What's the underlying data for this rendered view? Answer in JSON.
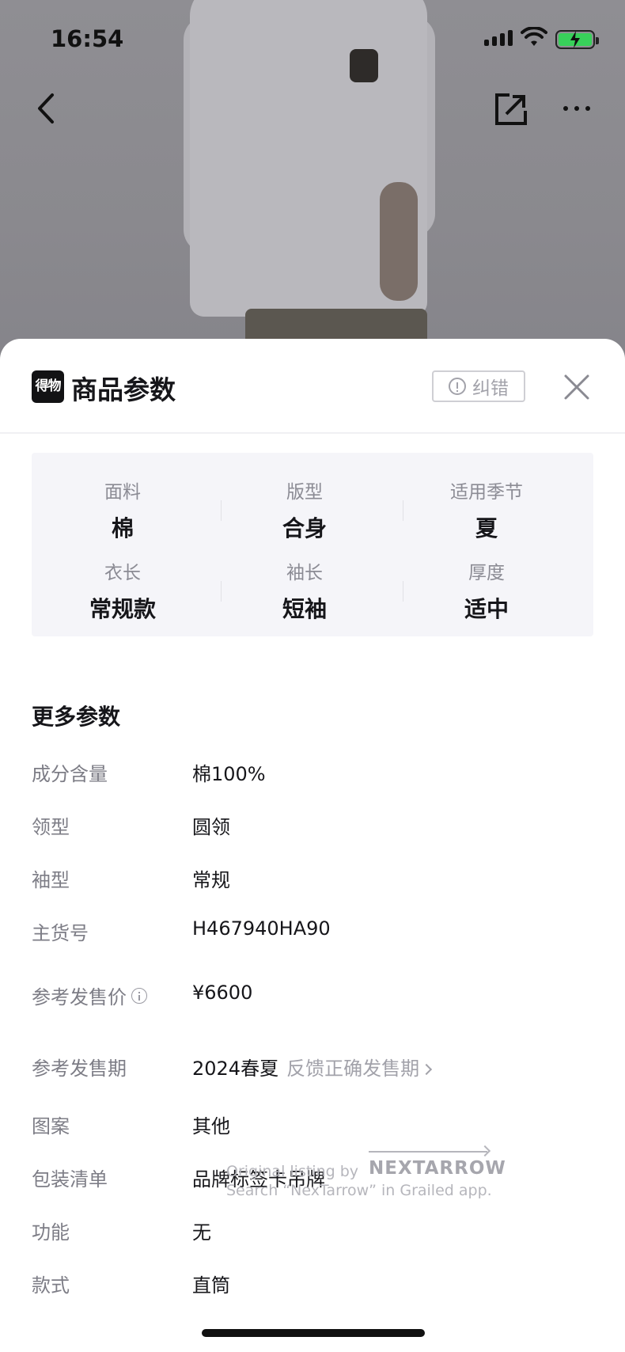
{
  "status_bar": {
    "time": "16:54",
    "battery_color": "#38d05a"
  },
  "nav": {
    "back_icon": "chevron-left-icon",
    "share_icon": "share-icon",
    "more_icon": "more-icon"
  },
  "sheet": {
    "brand_mark": "得物",
    "title": "商品参数",
    "report_label": "纠错",
    "close_icon": "close-icon",
    "attributes": [
      {
        "label": "面料",
        "value": "棉"
      },
      {
        "label": "版型",
        "value": "合身"
      },
      {
        "label": "适用季节",
        "value": "夏"
      },
      {
        "label": "衣长",
        "value": "常规款"
      },
      {
        "label": "袖长",
        "value": "短袖"
      },
      {
        "label": "厚度",
        "value": "适中"
      }
    ],
    "more_title": "更多参数",
    "params": [
      {
        "label": "成分含量",
        "value": "棉100%"
      },
      {
        "label": "领型",
        "value": "圆领"
      },
      {
        "label": "袖型",
        "value": "常规"
      },
      {
        "label": "主货号",
        "value": "H467940HA90"
      },
      {
        "label": "参考发售价",
        "value": "¥6600"
      },
      {
        "label": "参考发售期",
        "value": "2024春夏",
        "link": "反馈正确发售期"
      },
      {
        "label": "图案",
        "value": "其他"
      },
      {
        "label": "包装清单",
        "value": "品牌标签卡吊牌"
      },
      {
        "label": "功能",
        "value": "无"
      },
      {
        "label": "款式",
        "value": "直筒"
      }
    ]
  },
  "watermark": {
    "line1": "Original listing by",
    "brand": "NEXTARROW",
    "line2": "Search “NexTarrow” in Grailed app."
  }
}
